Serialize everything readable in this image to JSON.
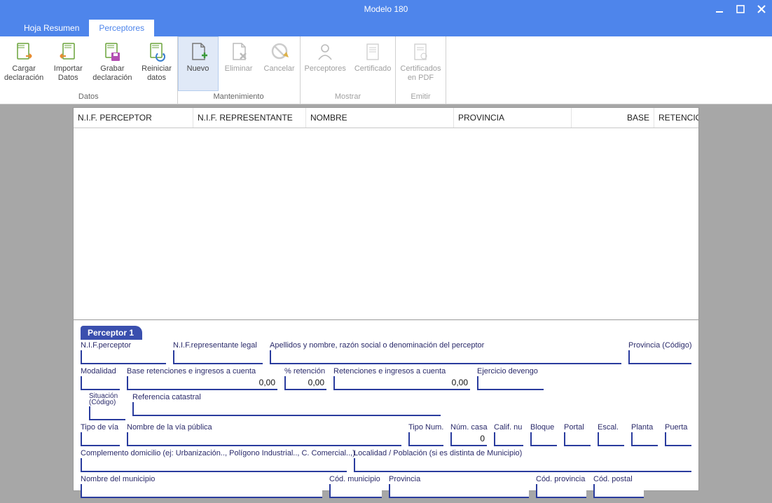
{
  "window": {
    "title": "Modelo 180"
  },
  "tabs": {
    "hoja": "Hoja Resumen",
    "perceptores": "Perceptores"
  },
  "ribbon": {
    "datos": {
      "label": "Datos",
      "cargar": "Cargar\ndeclaración",
      "importar": "Importar\nDatos",
      "grabar": "Grabar\ndeclaración",
      "reiniciar": "Reiniciar\ndatos"
    },
    "mant": {
      "label": "Mantenimiento",
      "nuevo": "Nuevo",
      "eliminar": "Eliminar",
      "cancelar": "Cancelar"
    },
    "mostrar": {
      "label": "Mostrar",
      "perceptores": "Perceptores",
      "certificado": "Certificado"
    },
    "emitir": {
      "label": "Emitir",
      "certpdf": "Certificados\nen PDF"
    }
  },
  "grid": {
    "headers": {
      "nif_perceptor": "N.I.F. PERCEPTOR",
      "nif_rep": "N.I.F. REPRESENTANTE",
      "nombre": "NOMBRE",
      "provincia": "PROVINCIA",
      "base": "BASE",
      "retenciones": "RETENCIONES"
    }
  },
  "detailTab": "Perceptor 1",
  "form": {
    "nif_perceptor": {
      "label": "N.I.F.perceptor",
      "value": ""
    },
    "nif_rep_legal": {
      "label": "N.I.F.representante legal",
      "value": ""
    },
    "apellidos": {
      "label": "Apellidos y nombre, razón social o denominación del perceptor",
      "value": ""
    },
    "provincia_cod": {
      "label": "Provincia (Código)",
      "value": ""
    },
    "modalidad": {
      "label": "Modalidad",
      "value": ""
    },
    "base_ret": {
      "label": "Base retenciones e ingresos a cuenta",
      "value": "0,00"
    },
    "pct_ret": {
      "label": "% retención",
      "value": "0,00"
    },
    "ret_ing": {
      "label": "Retenciones e ingresos a cuenta",
      "value": "0,00"
    },
    "ejercicio": {
      "label": "Ejercicio devengo",
      "value": ""
    },
    "situacion": {
      "label": "Situación\n(Código)",
      "value": ""
    },
    "ref_catastral": {
      "label": "Referencia catastral",
      "value": ""
    },
    "tipo_via": {
      "label": "Tipo de vía",
      "value": ""
    },
    "nombre_via": {
      "label": "Nombre de la vía pública",
      "value": ""
    },
    "tipo_num": {
      "label": "Tipo Num.",
      "value": ""
    },
    "num_casa": {
      "label": "Núm. casa",
      "value": "0"
    },
    "calif_nu": {
      "label": "Calif. nu",
      "value": ""
    },
    "bloque": {
      "label": "Bloque",
      "value": ""
    },
    "portal": {
      "label": "Portal",
      "value": ""
    },
    "escal": {
      "label": "Escal.",
      "value": ""
    },
    "planta": {
      "label": "Planta",
      "value": ""
    },
    "puerta": {
      "label": "Puerta",
      "value": ""
    },
    "complemento": {
      "label": "Complemento domicilio (ej: Urbanización.., Polígono Industrial.., C. Comercial..,)",
      "value": ""
    },
    "localidad": {
      "label": "Localidad / Población (si es distinta de Municipio)",
      "value": ""
    },
    "municipio": {
      "label": "Nombre del municipio",
      "value": ""
    },
    "cod_municipio": {
      "label": "Cód. municipio",
      "value": ""
    },
    "provincia": {
      "label": "Provincia",
      "value": ""
    },
    "cod_provincia": {
      "label": "Cód. provincia",
      "value": ""
    },
    "cod_postal": {
      "label": "Cód. postal",
      "value": ""
    }
  }
}
